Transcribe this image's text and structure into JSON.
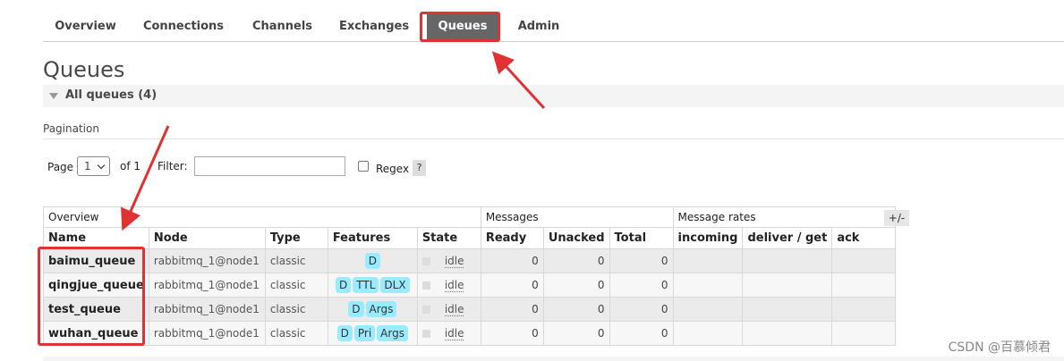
{
  "nav": {
    "tabs": [
      {
        "label": "Overview"
      },
      {
        "label": "Connections"
      },
      {
        "label": "Channels"
      },
      {
        "label": "Exchanges"
      },
      {
        "label": "Queues",
        "active": true
      },
      {
        "label": "Admin"
      }
    ]
  },
  "page_title": "Queues",
  "section": {
    "label": "All queues (4)"
  },
  "pagination": {
    "title": "Pagination",
    "page_label": "Page",
    "page_value": "1",
    "of_label": "of 1",
    "filter_label": "Filter:",
    "filter_value": "",
    "regex_label": "Regex",
    "help_label": "?"
  },
  "table": {
    "groups": {
      "overview": "Overview",
      "messages": "Messages",
      "rates": "Message rates"
    },
    "columns": {
      "name": "Name",
      "node": "Node",
      "type": "Type",
      "features": "Features",
      "state": "State",
      "ready": "Ready",
      "unacked": "Unacked",
      "total": "Total",
      "incoming": "incoming",
      "deliver": "deliver / get",
      "ack": "ack"
    },
    "plus_minus": "+/-",
    "rows": [
      {
        "name": "baimu_queue",
        "node": "rabbitmq_1@node1",
        "type": "classic",
        "features": [
          "D"
        ],
        "state": "idle",
        "ready": "0",
        "unacked": "0",
        "total": "0"
      },
      {
        "name": "qingjue_queue",
        "node": "rabbitmq_1@node1",
        "type": "classic",
        "features": [
          "D",
          "TTL",
          "DLX"
        ],
        "state": "idle",
        "ready": "0",
        "unacked": "0",
        "total": "0"
      },
      {
        "name": "test_queue",
        "node": "rabbitmq_1@node1",
        "type": "classic",
        "features": [
          "D",
          "Args"
        ],
        "state": "idle",
        "ready": "0",
        "unacked": "0",
        "total": "0"
      },
      {
        "name": "wuhan_queue",
        "node": "rabbitmq_1@node1",
        "type": "classic",
        "features": [
          "D",
          "Pri",
          "Args"
        ],
        "state": "idle",
        "ready": "0",
        "unacked": "0",
        "total": "0"
      }
    ]
  },
  "watermark": "CSDN @百慕倾君",
  "colors": {
    "active_tab": "#666666",
    "badge": "#99ebff",
    "annotation": "#e03232"
  }
}
